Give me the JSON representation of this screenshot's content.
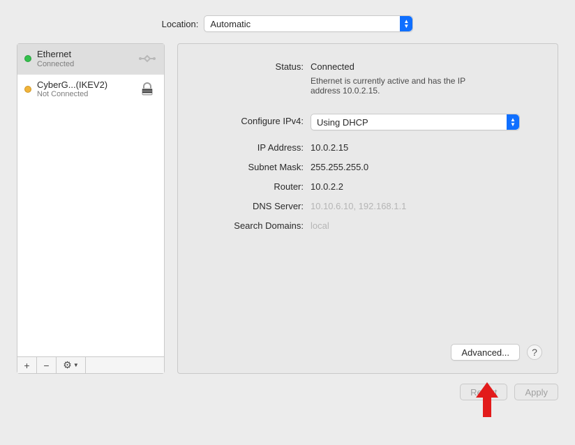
{
  "header": {
    "location_label": "Location:",
    "location_value": "Automatic"
  },
  "sidebar": {
    "items": [
      {
        "name": "Ethernet",
        "status": "Connected",
        "dot": "green",
        "icon": "ethernet"
      },
      {
        "name": "CyberG...(IKEV2)",
        "status": "Not Connected",
        "dot": "yellow",
        "icon": "lock"
      }
    ],
    "toolbar": {
      "add": "+",
      "remove": "−",
      "gear": "⚙︎▾"
    }
  },
  "main": {
    "status_label": "Status:",
    "status_value": "Connected",
    "status_desc": "Ethernet is currently active and has the IP address 10.0.2.15.",
    "configure_label": "Configure IPv4:",
    "configure_value": "Using DHCP",
    "rows": [
      {
        "label": "IP Address:",
        "value": "10.0.2.15",
        "placeholder": false
      },
      {
        "label": "Subnet Mask:",
        "value": "255.255.255.0",
        "placeholder": false
      },
      {
        "label": "Router:",
        "value": "10.0.2.2",
        "placeholder": false
      },
      {
        "label": "DNS Server:",
        "value": "10.10.6.10, 192.168.1.1",
        "placeholder": true
      },
      {
        "label": "Search Domains:",
        "value": "local",
        "placeholder": true
      }
    ],
    "advanced_button": "Advanced...",
    "help_tooltip": "?"
  },
  "footer": {
    "revert": "Revert",
    "apply": "Apply"
  }
}
